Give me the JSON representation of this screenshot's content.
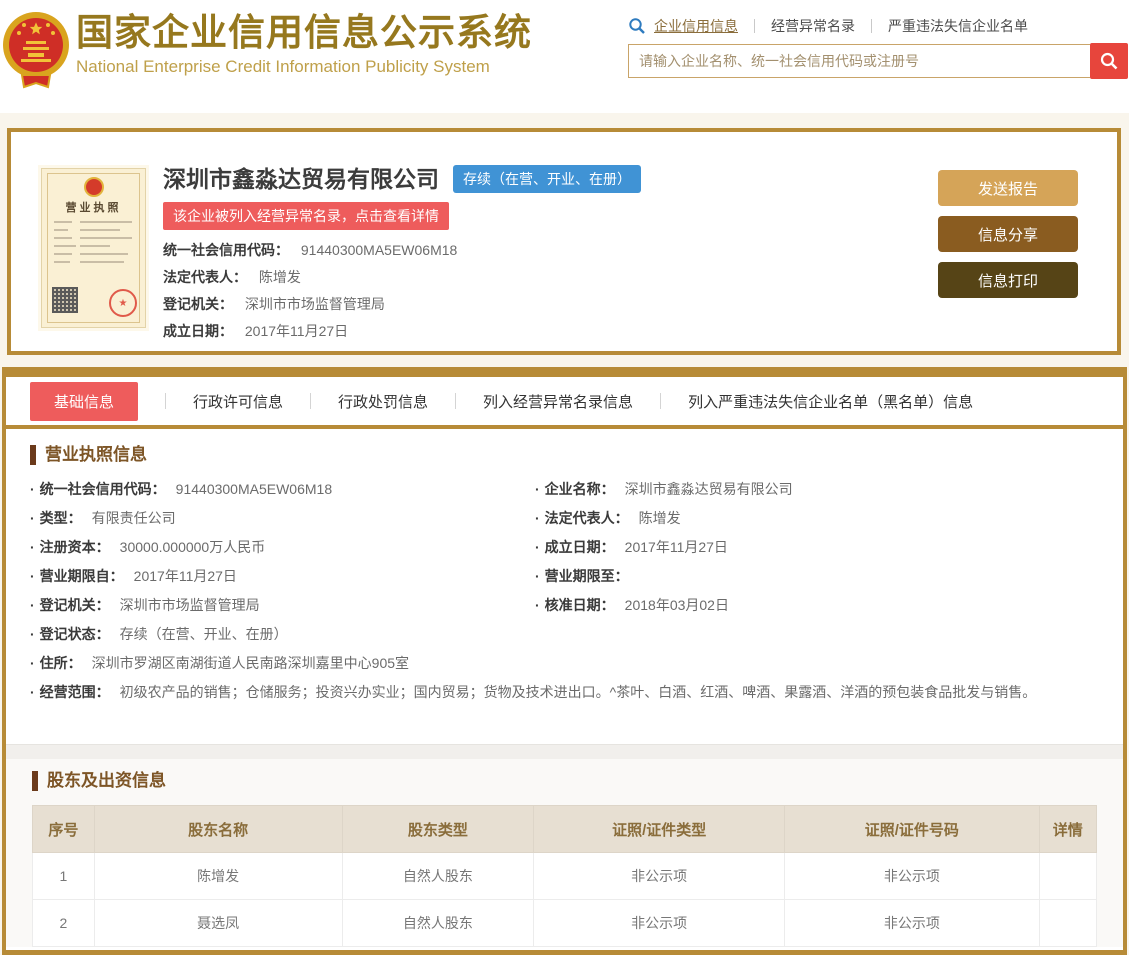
{
  "header": {
    "title_cn": "国家企业信用信息公示系统",
    "title_en": "National Enterprise Credit Information Publicity System",
    "nav": {
      "links": [
        {
          "label": "企业信用信息",
          "active": true
        },
        {
          "label": "经营异常名录",
          "active": false
        },
        {
          "label": "严重违法失信企业名单",
          "active": false
        }
      ]
    },
    "search": {
      "placeholder": "请输入企业名称、统一社会信用代码或注册号"
    }
  },
  "company_card": {
    "license_label": "营业执照",
    "name": "深圳市鑫淼达贸易有限公司",
    "status_badge": "存续（在营、开业、在册）",
    "warning_banner": "该企业被列入经营异常名录，点击查看详情",
    "fields": [
      {
        "label": "统一社会信用代码：",
        "value": "91440300MA5EW06M18"
      },
      {
        "label": "法定代表人：",
        "value": "陈增发"
      },
      {
        "label": "登记机关：",
        "value": "深圳市市场监督管理局"
      },
      {
        "label": "成立日期：",
        "value": "2017年11月27日"
      }
    ],
    "buttons": [
      {
        "label": "发送报告",
        "color": "#d5a458"
      },
      {
        "label": "信息分享",
        "color": "#8a5c20"
      },
      {
        "label": "信息打印",
        "color": "#564416"
      }
    ]
  },
  "tabs": [
    {
      "label": "基础信息",
      "active": true
    },
    {
      "label": "行政许可信息",
      "active": false
    },
    {
      "label": "行政处罚信息",
      "active": false
    },
    {
      "label": "列入经营异常名录信息",
      "active": false
    },
    {
      "label": "列入严重违法失信企业名单（黑名单）信息",
      "active": false
    }
  ],
  "license_section": {
    "title": "营业执照信息",
    "rows": [
      {
        "l_label": "统一社会信用代码：",
        "l_value": "91440300MA5EW06M18",
        "r_label": "企业名称：",
        "r_value": "深圳市鑫淼达贸易有限公司"
      },
      {
        "l_label": "类型：",
        "l_value": "有限责任公司",
        "r_label": "法定代表人：",
        "r_value": "陈增发"
      },
      {
        "l_label": "注册资本：",
        "l_value": "30000.000000万人民币",
        "r_label": "成立日期：",
        "r_value": "2017年11月27日"
      },
      {
        "l_label": "营业期限自：",
        "l_value": "2017年11月27日",
        "r_label": "营业期限至：",
        "r_value": ""
      },
      {
        "l_label": "登记机关：",
        "l_value": "深圳市市场监督管理局",
        "r_label": "核准日期：",
        "r_value": "2018年03月02日"
      },
      {
        "l_label": "登记状态：",
        "l_value": "存续（在营、开业、在册）",
        "r_label": "",
        "r_value": ""
      }
    ],
    "full_rows": [
      {
        "label": "住所：",
        "value": "深圳市罗湖区南湖街道人民南路深圳嘉里中心905室"
      },
      {
        "label": "经营范围：",
        "value": "初级农产品的销售；仓储服务；投资兴办实业；国内贸易；货物及技术进出口。^茶叶、白酒、红酒、啤酒、果露酒、洋酒的预包装食品批发与销售。"
      }
    ]
  },
  "shareholders": {
    "title": "股东及出资信息",
    "table": {
      "headers": [
        "序号",
        "股东名称",
        "股东类型",
        "证照/证件类型",
        "证照/证件号码",
        "详情"
      ],
      "rows": [
        [
          "1",
          "陈增发",
          "自然人股东",
          "非公示项",
          "非公示项",
          ""
        ],
        [
          "2",
          "聂选凤",
          "自然人股东",
          "非公示项",
          "非公示项",
          ""
        ]
      ]
    }
  },
  "colors": {
    "gold_border": "#b78b37",
    "page_background": "#f9f5ec",
    "brand_title": "#96781e",
    "active_tab_red": "#ee5c5c",
    "status_badge_blue": "#4093d5",
    "search_button_red": "#e7453c",
    "table_header_bg": "#e7dfd2"
  }
}
